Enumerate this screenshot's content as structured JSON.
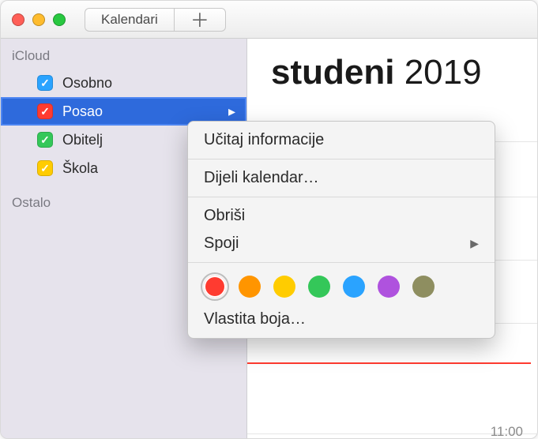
{
  "toolbar": {
    "calendars_label": "Kalendari",
    "add_tooltip": "Add"
  },
  "sidebar": {
    "group1": "iCloud",
    "group2": "Ostalo",
    "items": [
      {
        "label": "Osobno",
        "color": "#2aa3ff"
      },
      {
        "label": "Posao",
        "color": "#ff3b30"
      },
      {
        "label": "Obitelj",
        "color": "#34c759"
      },
      {
        "label": "Škola",
        "color": "#ffcc00"
      }
    ]
  },
  "main": {
    "month": "studeni",
    "year": "2019",
    "time_label": "11:00"
  },
  "menu": {
    "get_info": "Učitaj informacije",
    "share": "Dijeli kalendar…",
    "delete": "Obriši",
    "merge": "Spoji",
    "custom_color": "Vlastita boja…",
    "colors": [
      "#ff3b30",
      "#ff9500",
      "#ffcc00",
      "#34c759",
      "#2aa3ff",
      "#af52de",
      "#8e8e60"
    ]
  }
}
